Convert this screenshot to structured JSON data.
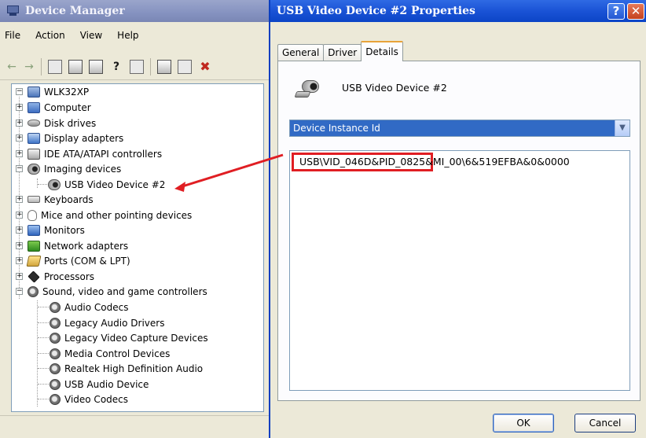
{
  "device_manager": {
    "title": "Device Manager",
    "menu": [
      "File",
      "Action",
      "View",
      "Help"
    ],
    "tree": {
      "root": "WLK32XP",
      "categories": [
        "Computer",
        "Disk drives",
        "Display adapters",
        "IDE ATA/ATAPI controllers",
        "Imaging devices",
        "Keyboards",
        "Mice and other pointing devices",
        "Monitors",
        "Network adapters",
        "Ports (COM & LPT)",
        "Processors",
        "Sound, video and game controllers"
      ],
      "imaging_children": [
        "USB Video Device #2"
      ],
      "sound_children": [
        "Audio Codecs",
        "Legacy Audio Drivers",
        "Legacy Video Capture Devices",
        "Media Control Devices",
        "Realtek High Definition Audio",
        "USB Audio Device",
        "Video Codecs"
      ]
    }
  },
  "properties": {
    "title": "USB Video Device #2 Properties",
    "help_glyph": "?",
    "close_glyph": "✕",
    "tabs": [
      "General",
      "Driver",
      "Details"
    ],
    "active_tab": "Details",
    "device_name": "USB Video Device #2",
    "property_select": "Device Instance Id",
    "value_highlighted": "USB\\VID_046D&PID_0825",
    "value_rest": "&MI_00\\6&519EFBA&0&0000",
    "ok_label": "OK",
    "cancel_label": "Cancel"
  },
  "colors": {
    "highlight_box": "#e01e23",
    "annotation_arrow": "#e01e23",
    "selection_blue": "#316ac5"
  }
}
